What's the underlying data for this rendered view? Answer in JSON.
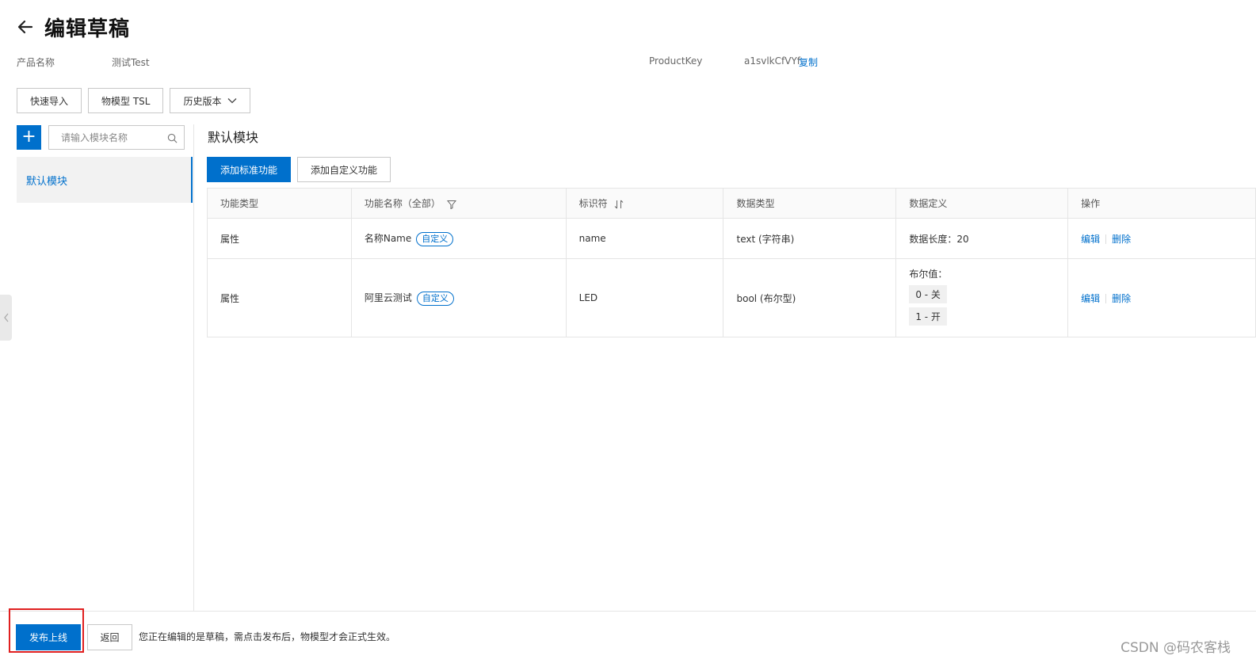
{
  "header": {
    "title": "编辑草稿"
  },
  "meta": {
    "product_name_label": "产品名称",
    "product_name_value": "测试Test",
    "product_key_label": "ProductKey",
    "product_key_value": "a1svlkCfVYf",
    "copy_label": "复制"
  },
  "toolbar": {
    "quick_import": "快速导入",
    "tsl": "物模型 TSL",
    "history": "历史版本"
  },
  "sidebar": {
    "add_label": "+",
    "search_placeholder": "请输入模块名称",
    "items": [
      {
        "label": "默认模块"
      }
    ]
  },
  "main": {
    "module_title": "默认模块",
    "add_standard": "添加标准功能",
    "add_custom": "添加自定义功能",
    "columns": [
      "功能类型",
      "功能名称（全部）",
      "标识符",
      "数据类型",
      "数据定义",
      "操作"
    ],
    "rows": [
      {
        "type": "属性",
        "name": "名称Name",
        "tag": "自定义",
        "identifier": "name",
        "data_type": "text (字符串)",
        "definition": "数据长度：20",
        "edit": "编辑",
        "delete": "删除"
      },
      {
        "type": "属性",
        "name": "阿里云测试",
        "tag": "自定义",
        "identifier": "LED",
        "data_type": "bool (布尔型)",
        "definition_label": "布尔值：",
        "enum": [
          "0 - 关",
          "1 - 开"
        ],
        "edit": "编辑",
        "delete": "删除"
      }
    ]
  },
  "footer": {
    "publish": "发布上线",
    "return": "返回",
    "notice": "您正在编辑的是草稿，需点击发布后，物模型才会正式生效。"
  },
  "watermark": "CSDN @码农客栈",
  "colors": {
    "primary": "#0070cc",
    "highlight_border": "#e02020"
  }
}
